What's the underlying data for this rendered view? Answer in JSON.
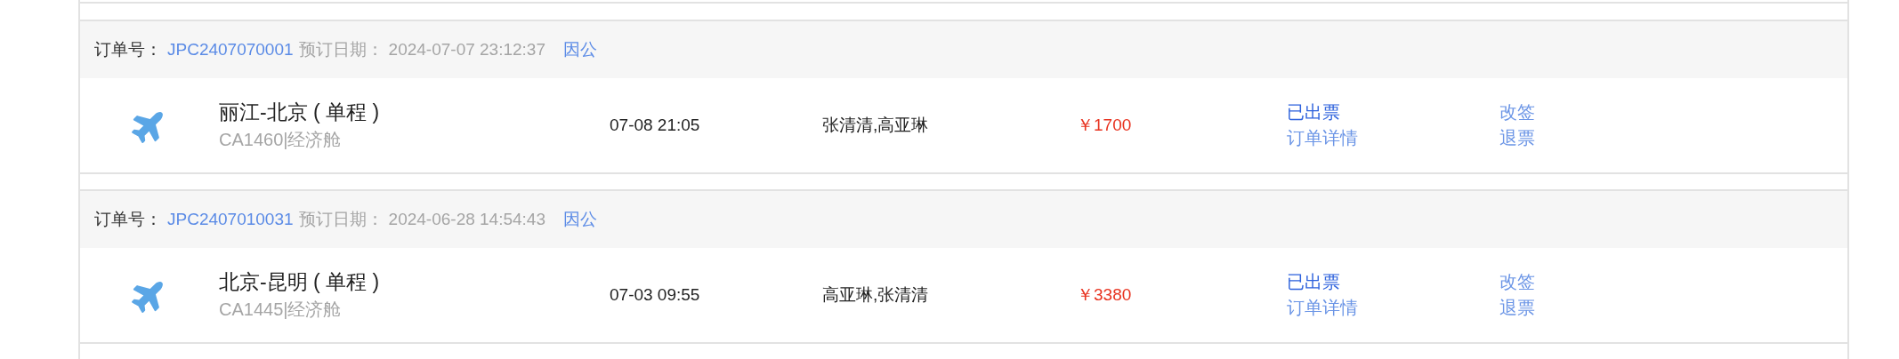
{
  "orders": [
    {
      "order_label": "订单号：",
      "order_no": "JPC2407070001",
      "date_label": "预订日期：",
      "date": "2024-07-07 23:12:37",
      "trip_type": "因公",
      "route": "丽江-北京 ( 单程 )",
      "flight": "CA1460|经济舱",
      "time": "07-08 21:05",
      "passengers": "张清清,高亚琳",
      "price": "￥1700",
      "status": "已出票",
      "detail": "订单详情",
      "actions": [
        "改签",
        "退票"
      ]
    },
    {
      "order_label": "订单号：",
      "order_no": "JPC2407010031",
      "date_label": "预订日期：",
      "date": "2024-06-28 14:54:43",
      "trip_type": "因公",
      "route": "北京-昆明 ( 单程 )",
      "flight": "CA1445|经济舱",
      "time": "07-03 09:55",
      "passengers": "高亚琳,张清清",
      "price": "￥3380",
      "status": "已出票",
      "detail": "订单详情",
      "actions": [
        "改签",
        "退票"
      ]
    }
  ]
}
